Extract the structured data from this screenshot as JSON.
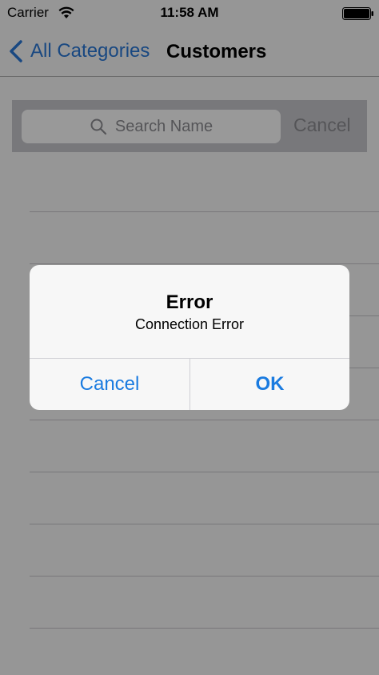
{
  "status_bar": {
    "carrier": "Carrier",
    "time": "11:58 AM",
    "wifi_icon": "wifi-icon",
    "battery_icon": "battery-icon"
  },
  "nav": {
    "back_label": "All Categories",
    "title": "Customers",
    "back_icon": "chevron-left-icon"
  },
  "search": {
    "placeholder": "Search Name",
    "cancel_label": "Cancel",
    "icon": "search-icon"
  },
  "alert": {
    "title": "Error",
    "message": "Connection Error",
    "cancel_label": "Cancel",
    "ok_label": "OK"
  },
  "colors": {
    "accent": "#1a7be0",
    "dim_overlay": "rgba(0,0,0,0.40)",
    "search_bar_bg": "#c9c9ce"
  }
}
